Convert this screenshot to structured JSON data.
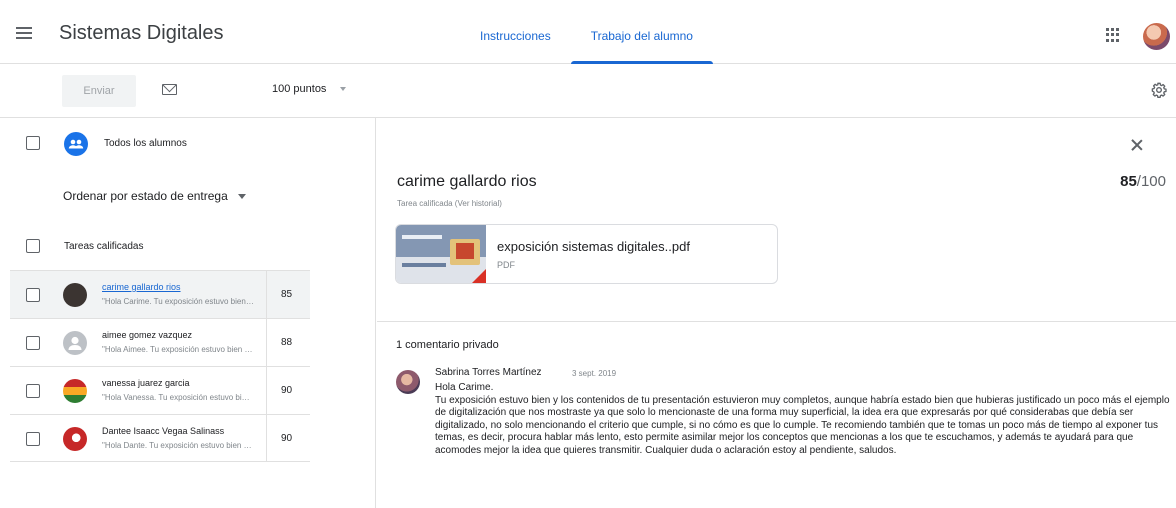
{
  "header": {
    "course_title": "Sistemas Digitales",
    "tabs": [
      {
        "label": "Instrucciones",
        "active": false
      },
      {
        "label": "Trabajo del alumno",
        "active": true
      }
    ],
    "icons": {
      "menu": "hamburger-menu-icon",
      "apps": "apps-grid-icon",
      "avatar": "user-avatar"
    }
  },
  "toolbar": {
    "send_label": "Enviar",
    "mail_icon": "mail-icon",
    "points": "100 puntos",
    "settings_icon": "gear-icon"
  },
  "left_panel": {
    "all_students_label": "Todos los alumnos",
    "sort_label": "Ordenar por estado de entrega",
    "group_label": "Tareas calificadas",
    "students": [
      {
        "name": "carime gallardo rios",
        "comment": "\"Hola Carime. Tu exposición estuvo bien y los contenidos de tu presentación",
        "grade": "85",
        "avatar_color": "#3b3431",
        "selected": true
      },
      {
        "name": "aimee gomez vazquez",
        "comment": "\"Hola Aimee. Tu exposición estuvo bien y los contenidos de tu presentación",
        "grade": "88",
        "avatar_color": "#9aa0a6",
        "selected": false
      },
      {
        "name": "vanessa juarez garcia",
        "comment": "\"Hola Vanessa. Tu exposición estuvo bien y los contenidos de tu presentación",
        "grade": "90",
        "avatar_color": "#2e7d32",
        "selected": false
      },
      {
        "name": "Dantee Isaacc Vegaa Salinass",
        "comment": "\"Hola Dante. Tu exposición estuvo bien y los contenidos de tu presentación",
        "grade": "90",
        "avatar_color": "#c62828",
        "selected": false
      }
    ]
  },
  "detail": {
    "student_name": "carime gallardo rios",
    "grade": "85",
    "grade_total": "/100",
    "status": "Tarea calificada (Ver historial)",
    "attachment": {
      "name": "exposición sistemas digitales..pdf",
      "type": "PDF"
    },
    "comments_header": "1 comentario privado",
    "comment": {
      "author": "Sabrina Torres Martínez",
      "date": "3 sept. 2019",
      "text": "Hola Carime.\nTu exposición estuvo bien y los contenidos de tu presentación estuvieron muy completos, aunque habría estado bien que hubieras justificado un poco más el ejemplo de digitalización que nos mostraste ya que solo lo mencionaste de una forma muy superficial, la idea era que expresarás por qué considerabas que debía ser digitalizado, no solo mencionando el criterio que cumple, si no cómo es que lo cumple. Te recomiendo también que te tomas un poco más de tiempo al exponer tus temas, es decir, procura hablar más lento, esto permite asimilar mejor los conceptos que mencionas a los que te escuchamos, y además te ayudará para que acomodes mejor la idea que quieres transmitir. Cualquier duda o aclaración estoy al pendiente, saludos."
    }
  },
  "colors": {
    "accent": "#1967d2",
    "divider": "#e0e0e0",
    "secondary_text": "#80868b"
  }
}
